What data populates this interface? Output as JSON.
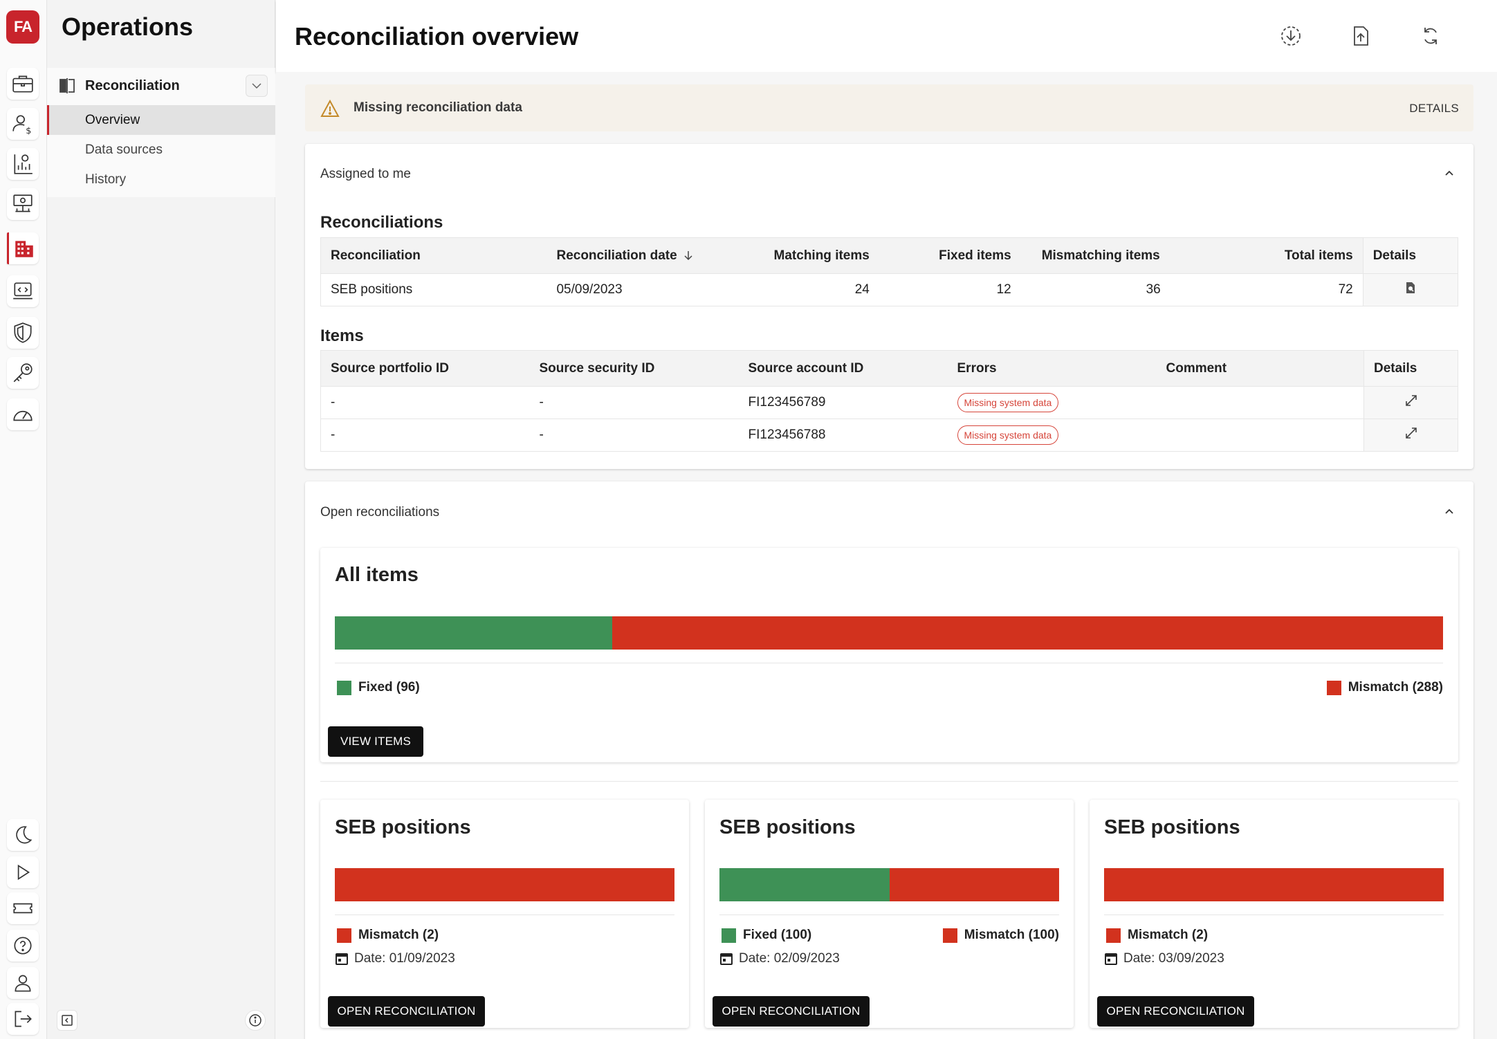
{
  "app": {
    "logo_text": "FA",
    "brand_color": "#c8242c"
  },
  "rail": {
    "items": [
      {
        "icon": "briefcase-icon"
      },
      {
        "icon": "user-money-icon"
      },
      {
        "icon": "report-chart-icon"
      },
      {
        "icon": "monitor-network-icon"
      },
      {
        "icon": "building-icon",
        "active": true
      },
      {
        "icon": "code-window-icon"
      },
      {
        "icon": "shield-icon"
      },
      {
        "icon": "key-icon"
      },
      {
        "icon": "speedometer-icon"
      }
    ],
    "bottom_items": [
      {
        "icon": "moon-icon"
      },
      {
        "icon": "play-icon"
      },
      {
        "icon": "ticket-icon"
      },
      {
        "icon": "help-icon"
      },
      {
        "icon": "user-icon"
      },
      {
        "icon": "logout-icon"
      }
    ]
  },
  "subnav": {
    "title": "Operations",
    "group_label": "Reconciliation",
    "items": [
      {
        "label": "Overview",
        "active": true
      },
      {
        "label": "Data sources"
      },
      {
        "label": "History"
      }
    ]
  },
  "header": {
    "title": "Reconciliation overview"
  },
  "alert": {
    "text": "Missing reconciliation data",
    "action": "DETAILS"
  },
  "assigned": {
    "heading": "Assigned to me",
    "reconciliations_title": "Reconciliations",
    "reconciliations_columns": [
      "Reconciliation",
      "Reconciliation date",
      "Matching items",
      "Fixed items",
      "Mismatching items",
      "Total items",
      "Details"
    ],
    "reconciliations_rows": [
      {
        "name": "SEB positions",
        "date": "05/09/2023",
        "matching": "24",
        "fixed": "12",
        "mismatching": "36",
        "total": "72"
      }
    ],
    "items_title": "Items",
    "items_columns": [
      "Source portfolio ID",
      "Source security ID",
      "Source account ID",
      "Errors",
      "Comment",
      "Details"
    ],
    "items_rows": [
      {
        "portfolio": "-",
        "security": "-",
        "account": "FI123456789",
        "error": "Missing system data",
        "comment": ""
      },
      {
        "portfolio": "-",
        "security": "-",
        "account": "FI123456788",
        "error": "Missing system data",
        "comment": ""
      }
    ]
  },
  "open": {
    "heading": "Open reconciliations",
    "all_items": {
      "title": "All items",
      "fixed_label": "Fixed (96)",
      "mismatch_label": "Mismatch (288)",
      "fixed": 96,
      "mismatch": 288,
      "button": "VIEW ITEMS"
    },
    "cards": [
      {
        "title": "SEB positions",
        "fixed": 0,
        "mismatch": 2,
        "fixed_label": "",
        "mismatch_label": "Mismatch (2)",
        "date": "Date: 01/09/2023",
        "button": "OPEN RECONCILIATION"
      },
      {
        "title": "SEB positions",
        "fixed": 100,
        "mismatch": 100,
        "fixed_label": "Fixed (100)",
        "mismatch_label": "Mismatch (100)",
        "date": "Date: 02/09/2023",
        "button": "OPEN RECONCILIATION"
      },
      {
        "title": "SEB positions",
        "fixed": 0,
        "mismatch": 2,
        "fixed_label": "",
        "mismatch_label": "Mismatch (2)",
        "date": "Date: 03/09/2023",
        "button": "OPEN RECONCILIATION"
      }
    ]
  },
  "colors": {
    "fixed": "#3e9156",
    "mismatch": "#d2321e"
  }
}
